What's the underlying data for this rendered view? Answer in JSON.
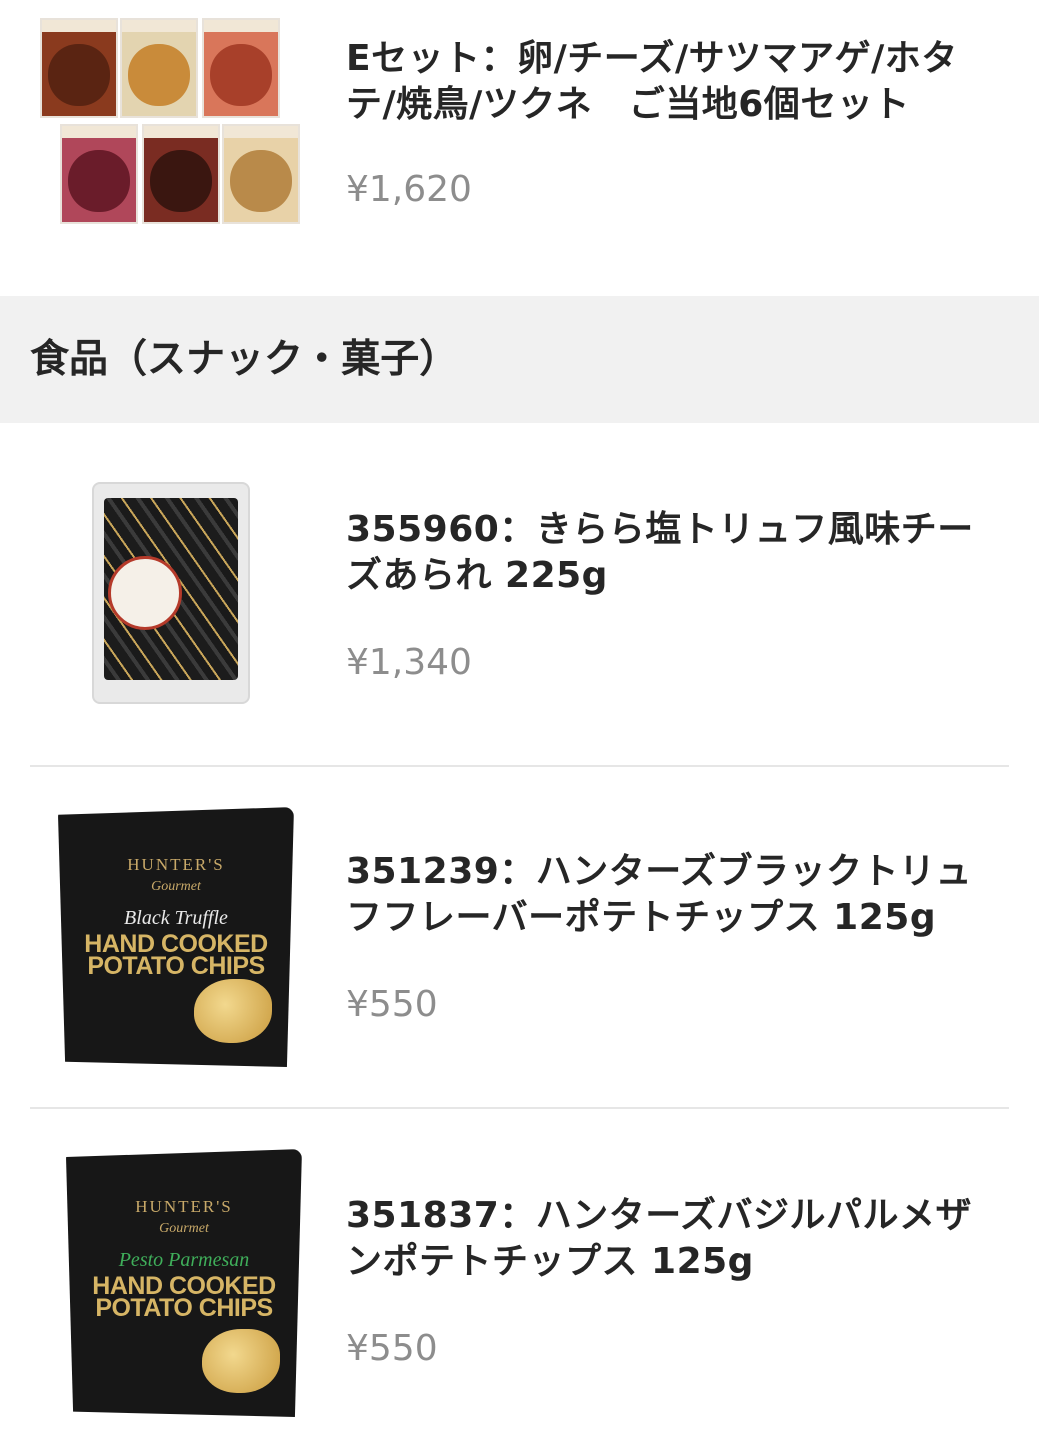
{
  "items_top": {
    "title": "Eセット：卵/チーズ/サツマアゲ/ホタテ/焼鳥/ツクネ　ご当地6個セット",
    "price": "¥1,620"
  },
  "section": {
    "title": "食品（スナック・菓子）"
  },
  "products": [
    {
      "title": "355960：きらら塩トリュフ風味チーズあられ 225g",
      "price": "¥1,340"
    },
    {
      "title": "351239：ハンターズブラックトリュフフレーバーポテトチップス 125g",
      "price": "¥550",
      "pack_brand": "HUNTER'S",
      "pack_sub": "Gourmet",
      "pack_flavor": "Black Truffle",
      "pack_main": "HAND COOKED POTATO CHIPS"
    },
    {
      "title": "351837：ハンターズバジルパルメザンポテトチップス 125g",
      "price": "¥550",
      "pack_brand": "HUNTER'S",
      "pack_sub": "Gourmet",
      "pack_flavor": "Pesto Parmesan",
      "pack_main": "HAND COOKED POTATO CHIPS"
    }
  ],
  "colors": {
    "section_bg": "#f1f1f1",
    "price": "#8d8d8d",
    "black_truffle_flavor": "#e9e9e9",
    "pesto_flavor": "#3fae5a"
  }
}
